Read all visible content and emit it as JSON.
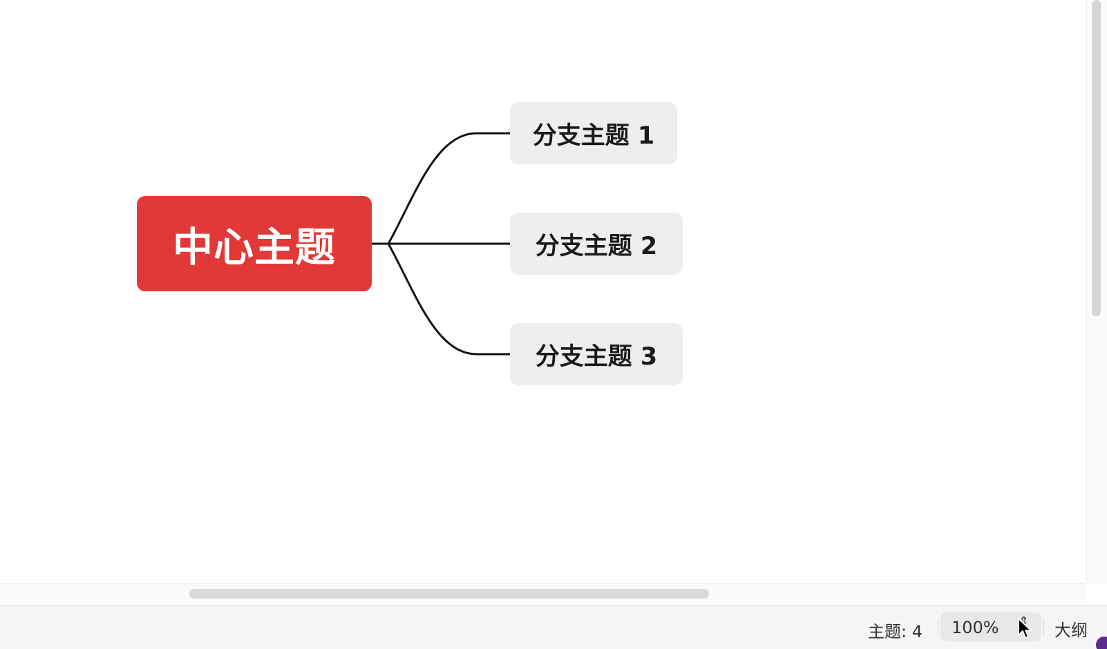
{
  "mindmap": {
    "central_topic": "中心主题",
    "branches": [
      {
        "label": "分支主题 1"
      },
      {
        "label": "分支主题 2"
      },
      {
        "label": "分支主题 3"
      }
    ]
  },
  "status_bar": {
    "topic_count_label": "主题: 4",
    "zoom_value": "100%",
    "zoom_stepper_glyph": "⇕",
    "outline_label": "大纲"
  },
  "colors": {
    "central_topic_bg": "#e33838",
    "branch_topic_bg": "#eeeeee",
    "connector": "#111111"
  },
  "icons": {
    "cursor": "arrow-cursor-icon",
    "zoom_stepper": "chevron-up-down-icon"
  }
}
